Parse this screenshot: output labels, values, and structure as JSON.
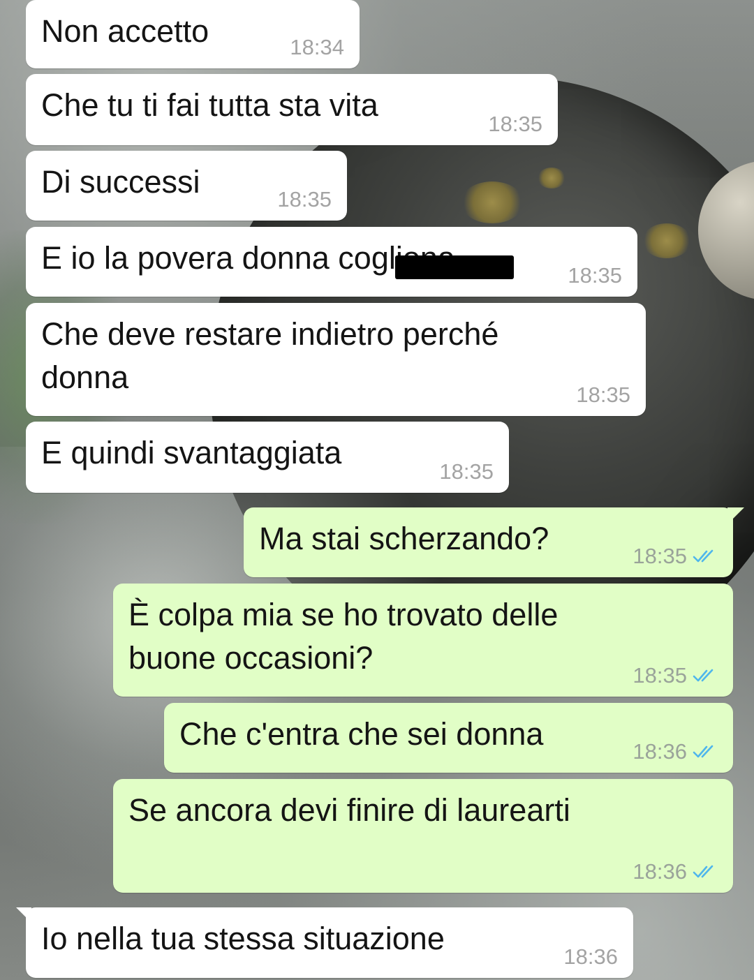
{
  "messages": [
    {
      "text": "Non accetto",
      "time": "18:34",
      "direction": "in"
    },
    {
      "text": "Che tu ti fai tutta sta vita",
      "time": "18:35",
      "direction": "in"
    },
    {
      "text": "Di successi",
      "time": "18:35",
      "direction": "in"
    },
    {
      "text": "E io la povera donna cogliona",
      "time": "18:35",
      "direction": "in",
      "redacted_part": "cogliona"
    },
    {
      "text": "Che deve restare indietro perché\ndonna",
      "time": "18:35",
      "direction": "in"
    },
    {
      "text": "E quindi svantaggiata",
      "time": "18:35",
      "direction": "in"
    },
    {
      "text": "Ma stai scherzando?",
      "time": "18:35",
      "direction": "out",
      "status": "read"
    },
    {
      "text": "È colpa mia se ho trovato delle\nbuone occasioni?",
      "time": "18:35",
      "direction": "out",
      "status": "read"
    },
    {
      "text": "Che c'entra che sei donna",
      "time": "18:36",
      "direction": "out",
      "status": "read"
    },
    {
      "text": "Se ancora devi finire di laurearti",
      "time": "18:36",
      "direction": "out",
      "status": "read"
    },
    {
      "text": "Io nella tua stessa situazione",
      "time": "18:36",
      "direction": "in"
    }
  ],
  "colors": {
    "incoming_bubble": "#ffffff",
    "outgoing_bubble": "#e1fec6",
    "read_tick": "#4fb6ec",
    "timestamp": "#a3a3a3"
  },
  "icons": {
    "read_status": "double-check-icon"
  }
}
